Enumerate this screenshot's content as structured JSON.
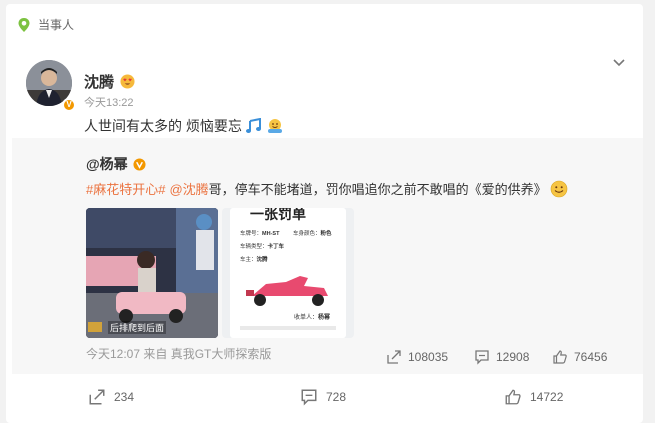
{
  "tag": {
    "label": "当事人"
  },
  "post": {
    "author": "沈腾",
    "time": "今天13:22",
    "text": "人世间有太多的 烦恼要忘"
  },
  "repost": {
    "author": "@杨幂",
    "hashtag": "#麻花特开心#",
    "mention": "@沈腾",
    "text": " 哥，停车不能堵道，罚你唱追你之前不敢唱的《爱的供养》",
    "images": [
      {
        "caption": "后排爬到后面"
      },
      {
        "title": "一张罚单",
        "car_no_label": "车牌号：",
        "car_no": "MH-ST",
        "color_label": "车身颜色：",
        "color": "粉色",
        "type_label": "车辆类型：",
        "type": "卡丁车",
        "owner_label": "车主：",
        "owner": "沈腾",
        "collector_label": "收单人：",
        "collector": "杨幂"
      }
    ],
    "meta": "今天12:07 来自 真我GT大师探索版",
    "shares": "108035",
    "comments": "12908",
    "likes": "76456"
  },
  "actions": {
    "shares": "234",
    "comments": "728",
    "likes": "14722"
  },
  "colors": {
    "accent": "#eb7340",
    "badge": "#f39800",
    "tag_green": "#7cc240"
  }
}
